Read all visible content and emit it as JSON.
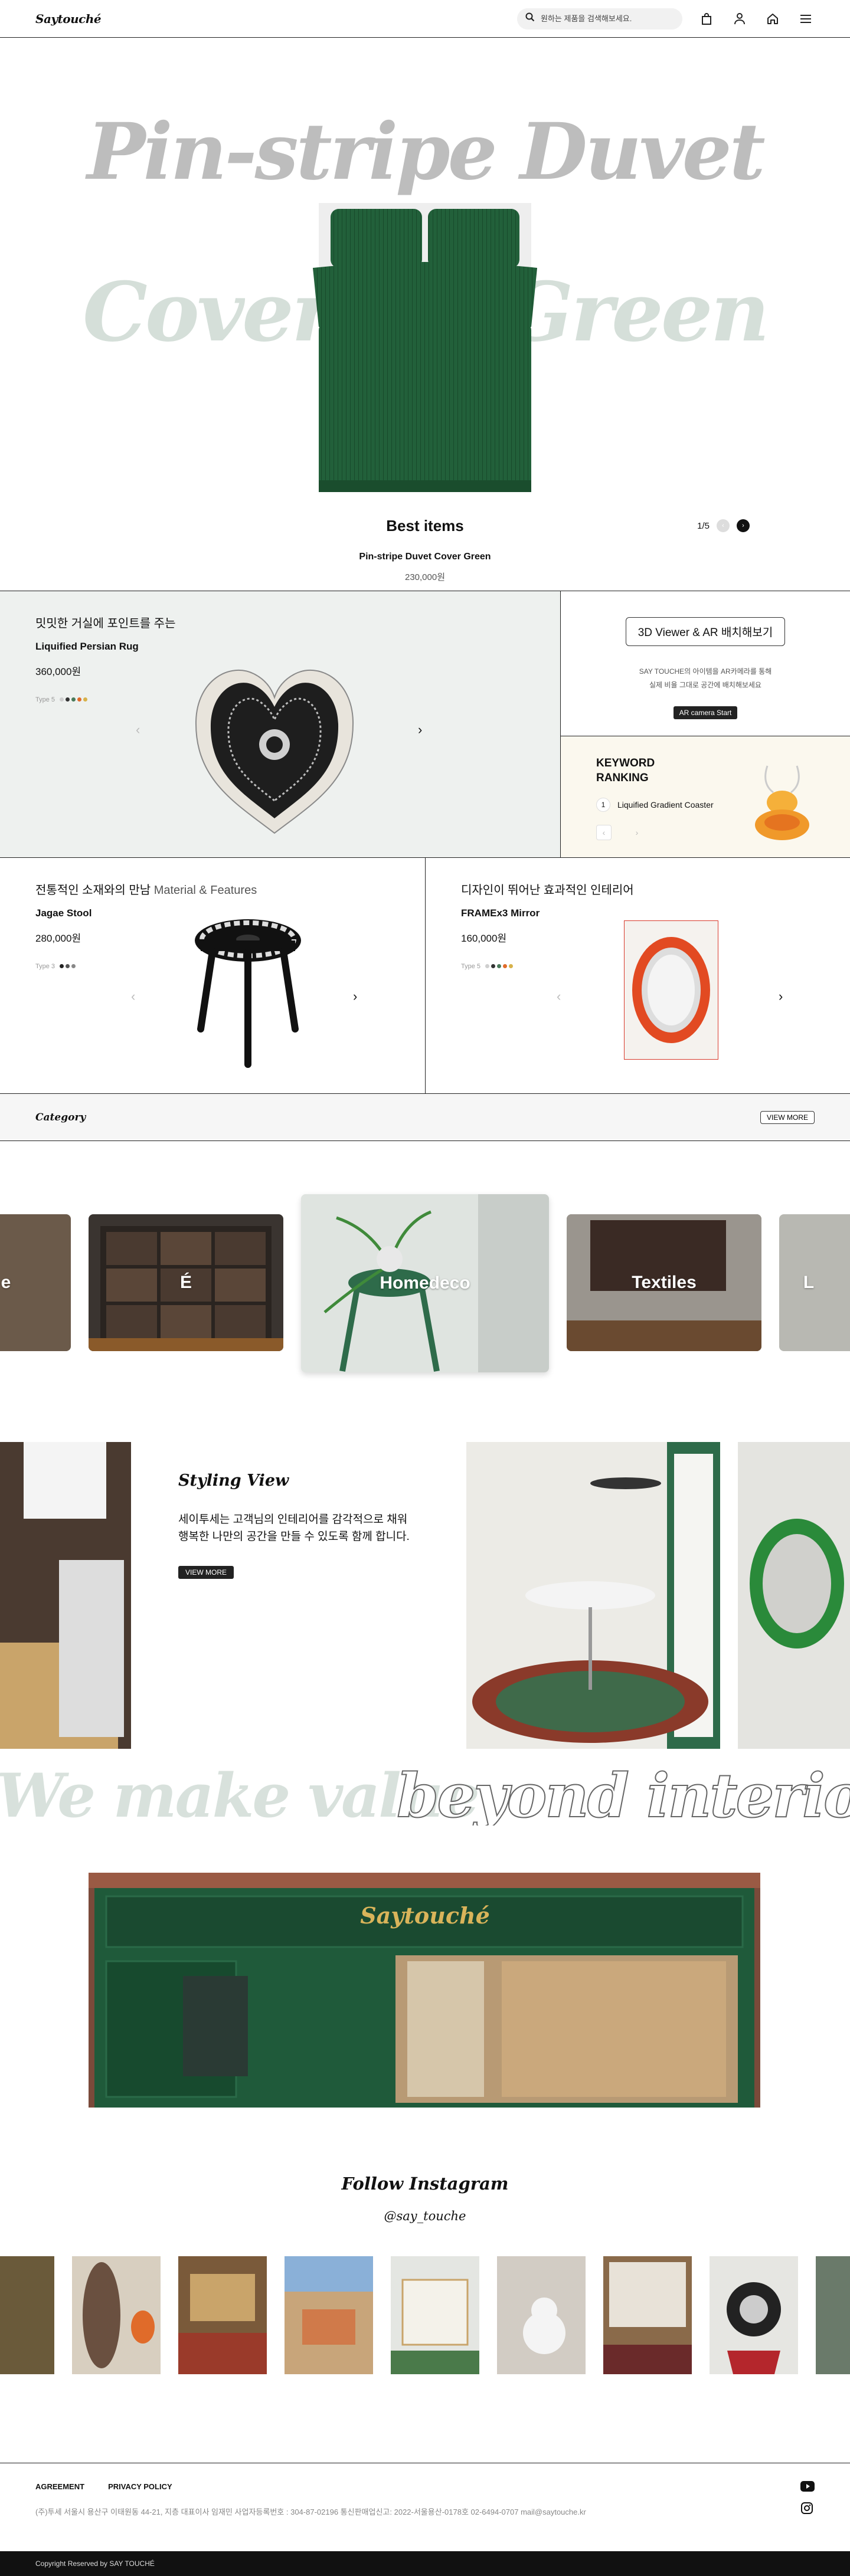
{
  "header": {
    "logo": "Saytouché",
    "search_placeholder": "원하는 제품을 검색해보세요.",
    "icons": [
      "search-icon",
      "cart-icon",
      "user-icon",
      "home-icon",
      "menu-icon"
    ]
  },
  "hero": {
    "title_line1": "Pin-stripe Duvet",
    "title_left": "Cover",
    "title_right": "Green",
    "section_label": "Best items",
    "product_name": "Pin-stripe Duvet Cover Green",
    "price": "230,000원",
    "pager": "1/5"
  },
  "rug": {
    "title": "밋밋한 거실에 포인트를 주는",
    "product_name": "Liquified Persian Rug",
    "price": "360,000원",
    "type_label": "Type 5",
    "swatches": [
      "#cfcfcf",
      "#333333",
      "#4a7a5a",
      "#e06b2a",
      "#d7b24a"
    ]
  },
  "ar": {
    "title": "3D Viewer & AR 배치해보기",
    "desc_line1": "SAY TOUCHE의 아이템을 AR카메라를 통해",
    "desc_line2": "실제 비율 그대로 공간에 배치해보세요",
    "button": "AR camera Start"
  },
  "ranking": {
    "title_line1": "KEYWORD",
    "title_line2": "RANKING",
    "rank": "1",
    "item": "Liquified Gradient Coaster"
  },
  "stool": {
    "title": "전통적인 소재와의 만남",
    "title_en": "Material & Features",
    "product_name": "Jagae Stool",
    "price": "280,000원",
    "type_label": "Type 3",
    "swatches": [
      "#222222",
      "#555555",
      "#888888"
    ]
  },
  "mirror": {
    "title": "디자인이 뛰어난 효과적인 인테리어",
    "product_name": "FRAMEx3 Mirror",
    "price": "160,000원",
    "type_label": "Type 5",
    "swatches": [
      "#cfcfcf",
      "#333333",
      "#4a7a5a",
      "#e06b2a",
      "#d7b24a"
    ]
  },
  "category": {
    "title": "Category",
    "view_more": "VIEW MORE",
    "cards": [
      "e",
      "É",
      "Homedeco",
      "Textiles",
      "L"
    ]
  },
  "styling": {
    "title": "Styling View",
    "desc_line1": "세이투세는 고객님의 인테리어를 감각적으로 채워",
    "desc_line2": "행복한 나만의 공간을 만들 수 있도록 함께 합니다.",
    "button": "VIEW MORE"
  },
  "marquee": {
    "part1": "We make value",
    "part2": "beyond interior p"
  },
  "store": {
    "sign": "Saytouché"
  },
  "instagram": {
    "title": "Follow Instagram",
    "handle": "@say_touche"
  },
  "footer": {
    "agreement": "AGREEMENT",
    "privacy": "PRIVACY POLICY",
    "address": "(주)투세  서울시 용산구 이태원동 44-21, 지층  대표이사 임재민 사업자등록번호 : 304-87-02196  통신판매업신고: 2022-서울용산-0178호  02-6494-0707   mail@saytouche.kr",
    "copyright": "Copyright Reserved by SAY TOUCHÉ"
  }
}
